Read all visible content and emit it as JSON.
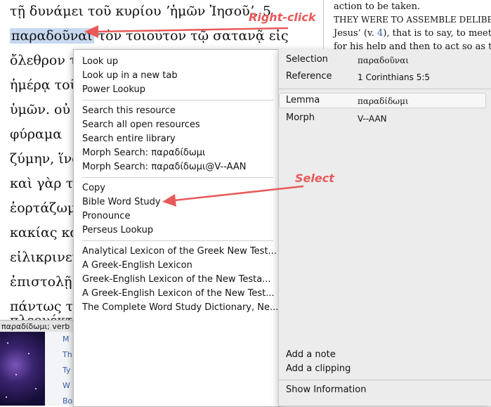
{
  "greek_text": {
    "lines": [
      "τῇ δυνάμει τοῦ κυρίου ʼἡμῶν Ἰησοῦʼ, 5",
      "τὸν τοιοῦτον τῷ σατανᾷ εἰς",
      "ὄλεθρον τ",
      "ἡμέρᾳ τοῦ",
      "ὑμῶν. οὐ",
      "φύραμα",
      "ζύμην, ἵνα",
      "καὶ γὰρ τὸ",
      "ἑορτάζωμ",
      "κακίας κα",
      "εἰλικρινεί",
      "ἐπιστολῇ",
      "πάντως το",
      "πλεονέκτ"
    ],
    "selected_word": "παραδοῦναι",
    "status_bar": "παραδίδωμι; verb"
  },
  "bottom_list_items": [
    "M",
    "Th",
    "Ty",
    "W",
    "Bo"
  ],
  "commentary": {
    "lines": [
      "action to be taken.",
      "THEY WERE TO ASSEMBLE DELIBERA",
      "Jesus’ (v.",
      "for his help and then to act so as to"
    ],
    "verse_ref": "4",
    "after_ref": "), that is to say, to meet to"
  },
  "annotations": {
    "right_click": "Right-click",
    "select": "Select"
  },
  "context_menu": {
    "groups": [
      [
        "Look up",
        "Look up in a new tab",
        "Power Lookup"
      ],
      [
        "Search this resource",
        "Search all open resources",
        "Search entire library",
        "Morph Search: παραδίδωμι",
        "Morph Search: παραδίδωμι@V--AAN"
      ],
      [
        "Copy",
        "Bible Word Study",
        "Pronounce",
        "Perseus Lookup"
      ],
      [
        "Analytical Lexicon of the Greek New Test...",
        "A Greek-English Lexicon",
        "Greek-English Lexicon of the New Testa...",
        "A Greek-English Lexicon of the New Test...",
        "The Complete Word Study Dictionary, Ne..."
      ]
    ]
  },
  "info_panel": {
    "selection_label": "Selection",
    "selection_value": "παραδοῦναι",
    "reference_label": "Reference",
    "reference_value": "1 Corinthians 5:5",
    "lemma_label": "Lemma",
    "lemma_value": "παραδίδωμι",
    "morph_label": "Morph",
    "morph_value": "V--AAN",
    "add_note": "Add a note",
    "add_clipping": "Add a clipping",
    "show_information": "Show Information"
  },
  "colors": {
    "annotation": "#e85a5a",
    "selection_highlight": "#c7d8ef",
    "link": "#3358a8"
  }
}
